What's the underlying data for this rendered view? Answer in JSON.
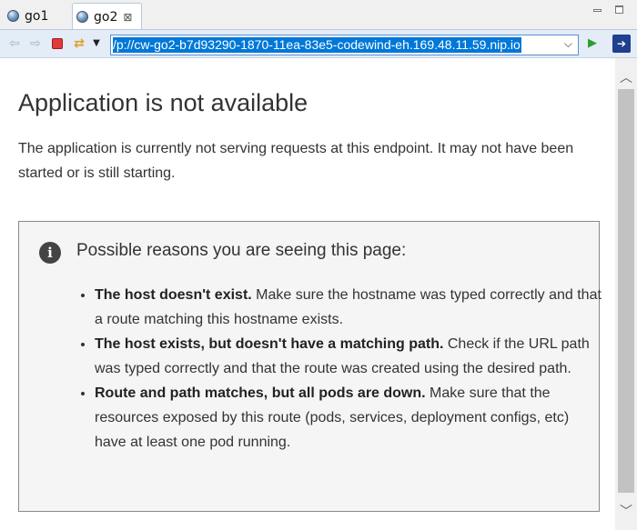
{
  "tabs": [
    {
      "label": "go1",
      "icon": "globe-icon"
    },
    {
      "label": "go2",
      "icon": "globe-icon",
      "close": "⊠"
    }
  ],
  "toolbar": {
    "url": "p://cw-go2-b7d93290-1870-11ea-83e5-codewind-eh.169.48.11.59.nip.io/",
    "icons": [
      "back-icon",
      "forward-icon",
      "stop-icon",
      "refresh-icon",
      "dropdown-icon",
      "go-icon",
      "open-external-icon"
    ]
  },
  "page": {
    "title": "Application is not available",
    "description": "The application is currently not serving requests at this endpoint. It may not have been started or is still starting.",
    "reasons_title": "Possible reasons you are seeing this page:",
    "reasons": [
      {
        "bold": "The host doesn't exist.",
        "text": " Make sure the hostname was typed correctly and that a route matching this hostname exists."
      },
      {
        "bold": "The host exists, but doesn't have a matching path.",
        "text": " Check if the URL path was typed correctly and that the route was created using the desired path."
      },
      {
        "bold": "Route and path matches, but all pods are down.",
        "text": " Make sure that the resources exposed by this route (pods, services, deployment configs, etc) have at least one pod running."
      }
    ]
  },
  "colors": {
    "url_selection": "#0078d7",
    "toolbar_bg": "#e3ecf7",
    "stop_red": "#e03a3a",
    "go_green": "#2e9d2e"
  }
}
